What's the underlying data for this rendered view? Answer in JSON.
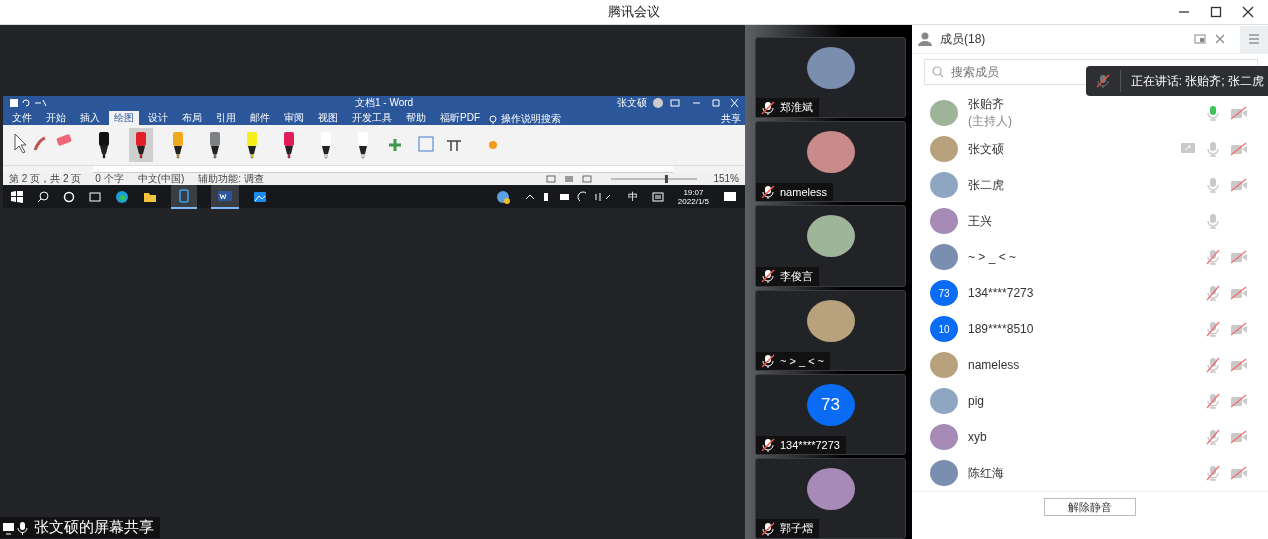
{
  "window": {
    "title": "腾讯会议"
  },
  "shared_screen": {
    "label": "张文硕的屏幕共享",
    "word": {
      "title": "文档1 - Word",
      "user": "张文硕",
      "share": "共享",
      "search_hint": "操作说明搜索",
      "tabs": [
        {
          "label": "文件",
          "selected": false
        },
        {
          "label": "开始",
          "selected": false
        },
        {
          "label": "插入",
          "selected": false
        },
        {
          "label": "绘图",
          "selected": true
        },
        {
          "label": "设计",
          "selected": false
        },
        {
          "label": "布局",
          "selected": false
        },
        {
          "label": "引用",
          "selected": false
        },
        {
          "label": "邮件",
          "selected": false
        },
        {
          "label": "审阅",
          "selected": false
        },
        {
          "label": "视图",
          "selected": false
        },
        {
          "label": "开发工具",
          "selected": false
        },
        {
          "label": "帮助",
          "selected": false
        },
        {
          "label": "福昕PDF",
          "selected": false
        }
      ],
      "pens": [
        {
          "color": "#111111",
          "selected": false
        },
        {
          "color": "#e3202a",
          "selected": true
        },
        {
          "color": "#f0a81c",
          "selected": false
        },
        {
          "color": "#7d8186",
          "selected": false
        },
        {
          "color": "#f4ee1a",
          "selected": false
        },
        {
          "color": "#e31c5a",
          "selected": false
        },
        {
          "color": "#ffffff",
          "selected": false
        },
        {
          "color": "#ffffff",
          "selected": false
        }
      ],
      "status": [
        "第 2 页，共 2 页",
        "0 个字",
        "中文(中国)",
        "辅助功能: 调查"
      ],
      "zoom_slider": {
        "level": 0.65
      },
      "zoom": "151%",
      "taskbar": {
        "ime": "中",
        "time": "19:07",
        "date": "2022/1/5"
      }
    }
  },
  "video_tiles": [
    {
      "name": "郑淮斌",
      "muted": true
    },
    {
      "name": "nameless",
      "muted": true
    },
    {
      "name": "李俊言",
      "muted": true
    },
    {
      "name": "~ > _ < ~",
      "muted": true
    },
    {
      "name": "134****7273",
      "avatar_text": "73",
      "muted": true
    },
    {
      "name": "郭子熠",
      "muted": true
    }
  ],
  "members_panel": {
    "title": "成员(18)",
    "search_placeholder": "搜索成员",
    "speaking_tip": "正在讲话: 张贻齐; 张二虎",
    "members": [
      {
        "name": "张贻齐",
        "role": "(主持人)",
        "muted": false,
        "speaking": true,
        "camera_off": true,
        "sharing": false
      },
      {
        "name": "张文硕",
        "muted": false,
        "speaking": false,
        "camera_off": true,
        "sharing": true
      },
      {
        "name": "张二虎",
        "muted": false,
        "speaking": false,
        "camera_off": true,
        "sharing": false
      },
      {
        "name": "王兴",
        "muted": false,
        "speaking": false,
        "camera_off": false,
        "sharing": false
      },
      {
        "name": "~ > _ < ~",
        "muted": true,
        "speaking": false,
        "camera_off": true,
        "sharing": false
      },
      {
        "name": "134****7273",
        "avatar_text": "73",
        "muted": true,
        "speaking": false,
        "camera_off": true,
        "sharing": false
      },
      {
        "name": "189****8510",
        "avatar_text": "10",
        "muted": true,
        "speaking": false,
        "camera_off": true,
        "sharing": false
      },
      {
        "name": "nameless",
        "muted": true,
        "speaking": false,
        "camera_off": true,
        "sharing": false
      },
      {
        "name": "pig",
        "muted": true,
        "speaking": false,
        "camera_off": true,
        "sharing": false
      },
      {
        "name": "xyb",
        "muted": true,
        "speaking": false,
        "camera_off": true,
        "sharing": false
      },
      {
        "name": "陈红海",
        "muted": true,
        "speaking": false,
        "camera_off": true,
        "sharing": false
      }
    ],
    "unmute_button": "解除静音"
  }
}
